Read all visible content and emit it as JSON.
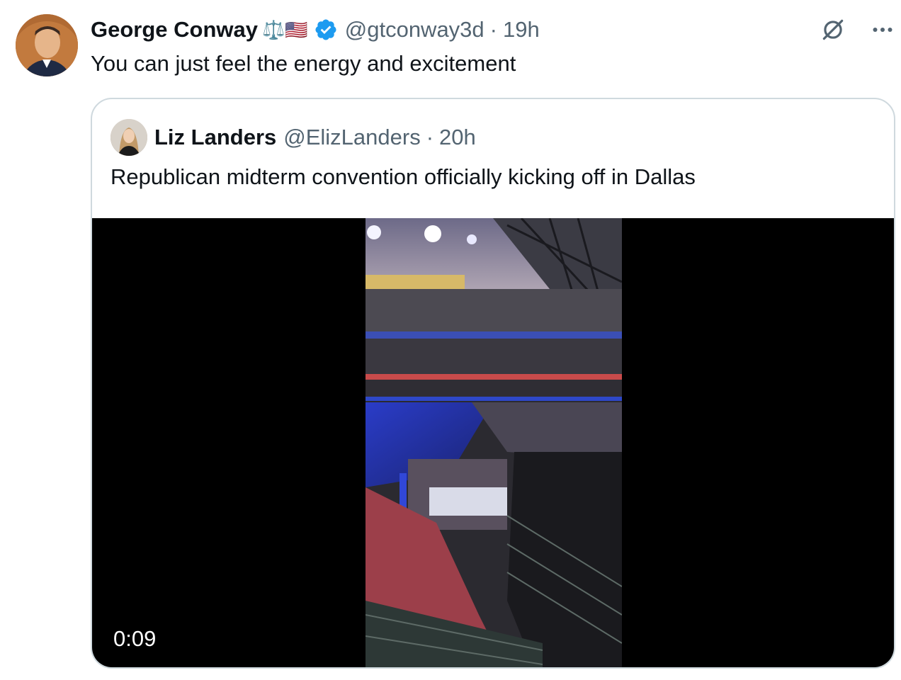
{
  "tweet": {
    "display_name": "George Conway",
    "name_emoji": "⚖️🇺🇸",
    "handle": "@gtconway3d",
    "separator": "·",
    "time": "19h",
    "text": "You can just feel the energy and excitement",
    "icons": [
      "avatar",
      "verified-badge-icon",
      "grok-icon",
      "more-options-icon"
    ]
  },
  "quoted_tweet": {
    "display_name": "Liz Landers",
    "handle": "@ElizLanders",
    "separator": "·",
    "time": "20h",
    "text": "Republican midterm convention officially kicking off in Dallas",
    "video": {
      "duration": "0:09"
    }
  },
  "colors": {
    "text_primary": "#0f1419",
    "text_secondary": "#536471",
    "verified_blue": "#1d9bf0",
    "border": "#cfd9de",
    "video_bg": "#000000"
  }
}
